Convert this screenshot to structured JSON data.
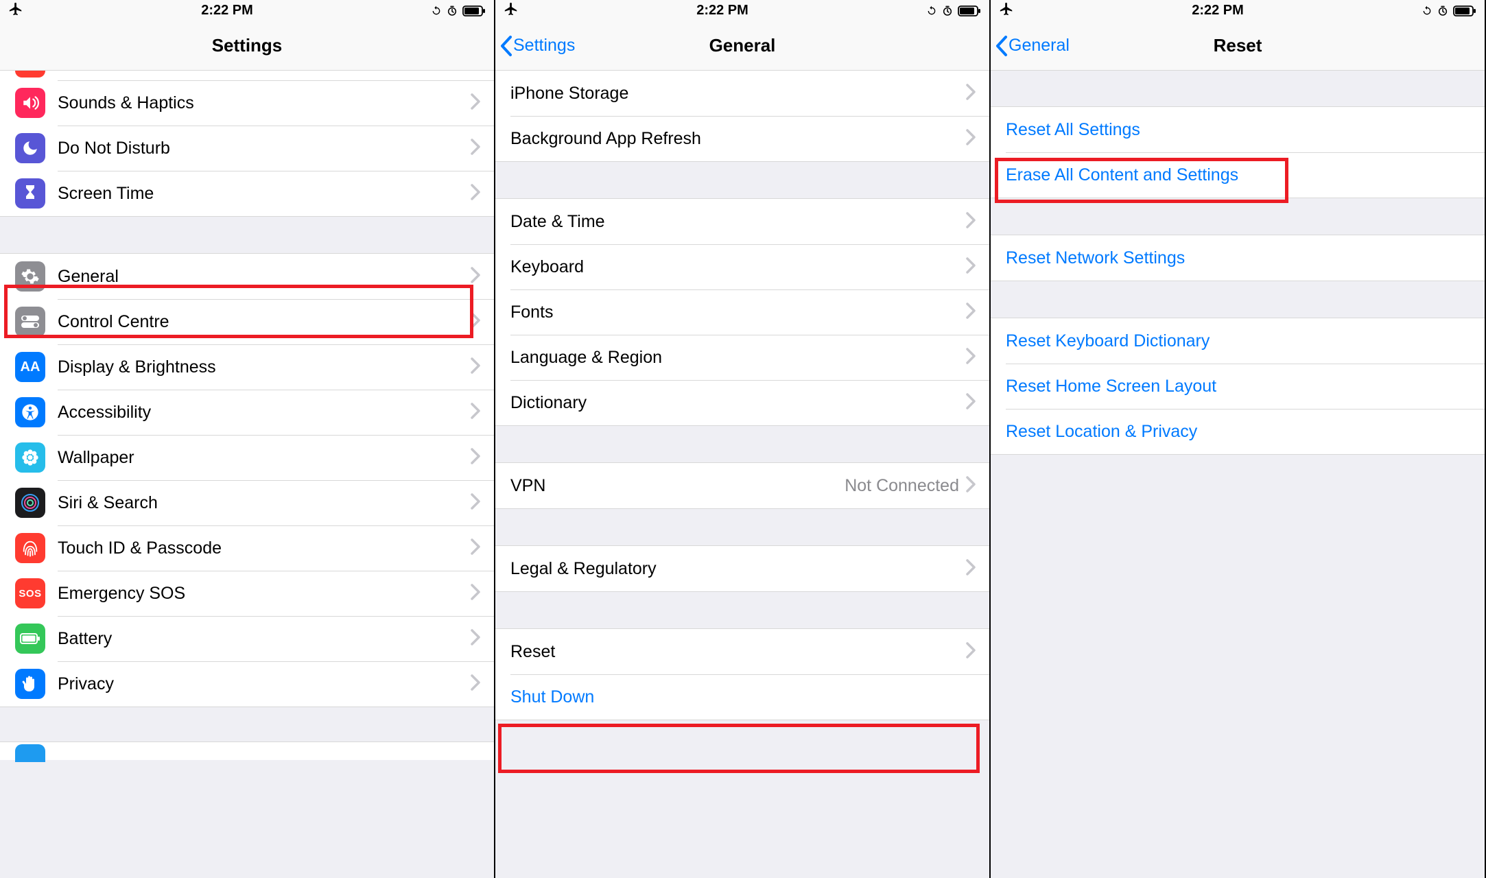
{
  "status": {
    "time": "2:22 PM"
  },
  "pane1": {
    "title": "Settings",
    "rows": [
      {
        "label": "Sounds & Haptics",
        "icon": "speaker",
        "bg": "#ff3b30"
      },
      {
        "label": "Do Not Disturb",
        "icon": "moon",
        "bg": "#5856d6"
      },
      {
        "label": "Screen Time",
        "icon": "hourglass",
        "bg": "#5856d6"
      }
    ],
    "rows2": [
      {
        "label": "General",
        "icon": "gear",
        "bg": "#8e8e93"
      },
      {
        "label": "Control Centre",
        "icon": "switches",
        "bg": "#8e8e93"
      },
      {
        "label": "Display & Brightness",
        "icon": "AA",
        "bg": "#007aff"
      },
      {
        "label": "Accessibility",
        "icon": "body",
        "bg": "#007aff"
      },
      {
        "label": "Wallpaper",
        "icon": "flower",
        "bg": "#2ac8fa"
      },
      {
        "label": "Siri & Search",
        "icon": "siri",
        "bg": "#1c1c1e"
      },
      {
        "label": "Touch ID & Passcode",
        "icon": "finger",
        "bg": "#ff3b30"
      },
      {
        "label": "Emergency SOS",
        "icon": "SOS",
        "bg": "#ff3b30"
      },
      {
        "label": "Battery",
        "icon": "battery",
        "bg": "#34c759"
      },
      {
        "label": "Privacy",
        "icon": "hand",
        "bg": "#007aff"
      }
    ]
  },
  "pane2": {
    "back": "Settings",
    "title": "General",
    "g1": [
      {
        "label": "iPhone Storage"
      },
      {
        "label": "Background App Refresh"
      }
    ],
    "g2": [
      {
        "label": "Date & Time"
      },
      {
        "label": "Keyboard"
      },
      {
        "label": "Fonts"
      },
      {
        "label": "Language & Region"
      },
      {
        "label": "Dictionary"
      }
    ],
    "g3": [
      {
        "label": "VPN",
        "value": "Not Connected"
      }
    ],
    "g4": [
      {
        "label": "Legal & Regulatory"
      }
    ],
    "g5": [
      {
        "label": "Reset"
      },
      {
        "label": "Shut Down",
        "blue": true,
        "noChevron": true
      }
    ]
  },
  "pane3": {
    "back": "General",
    "title": "Reset",
    "g1": [
      {
        "label": "Reset All Settings"
      },
      {
        "label": "Erase All Content and Settings"
      }
    ],
    "g2": [
      {
        "label": "Reset Network Settings"
      }
    ],
    "g3": [
      {
        "label": "Reset Keyboard Dictionary"
      },
      {
        "label": "Reset Home Screen Layout"
      },
      {
        "label": "Reset Location & Privacy"
      }
    ]
  }
}
